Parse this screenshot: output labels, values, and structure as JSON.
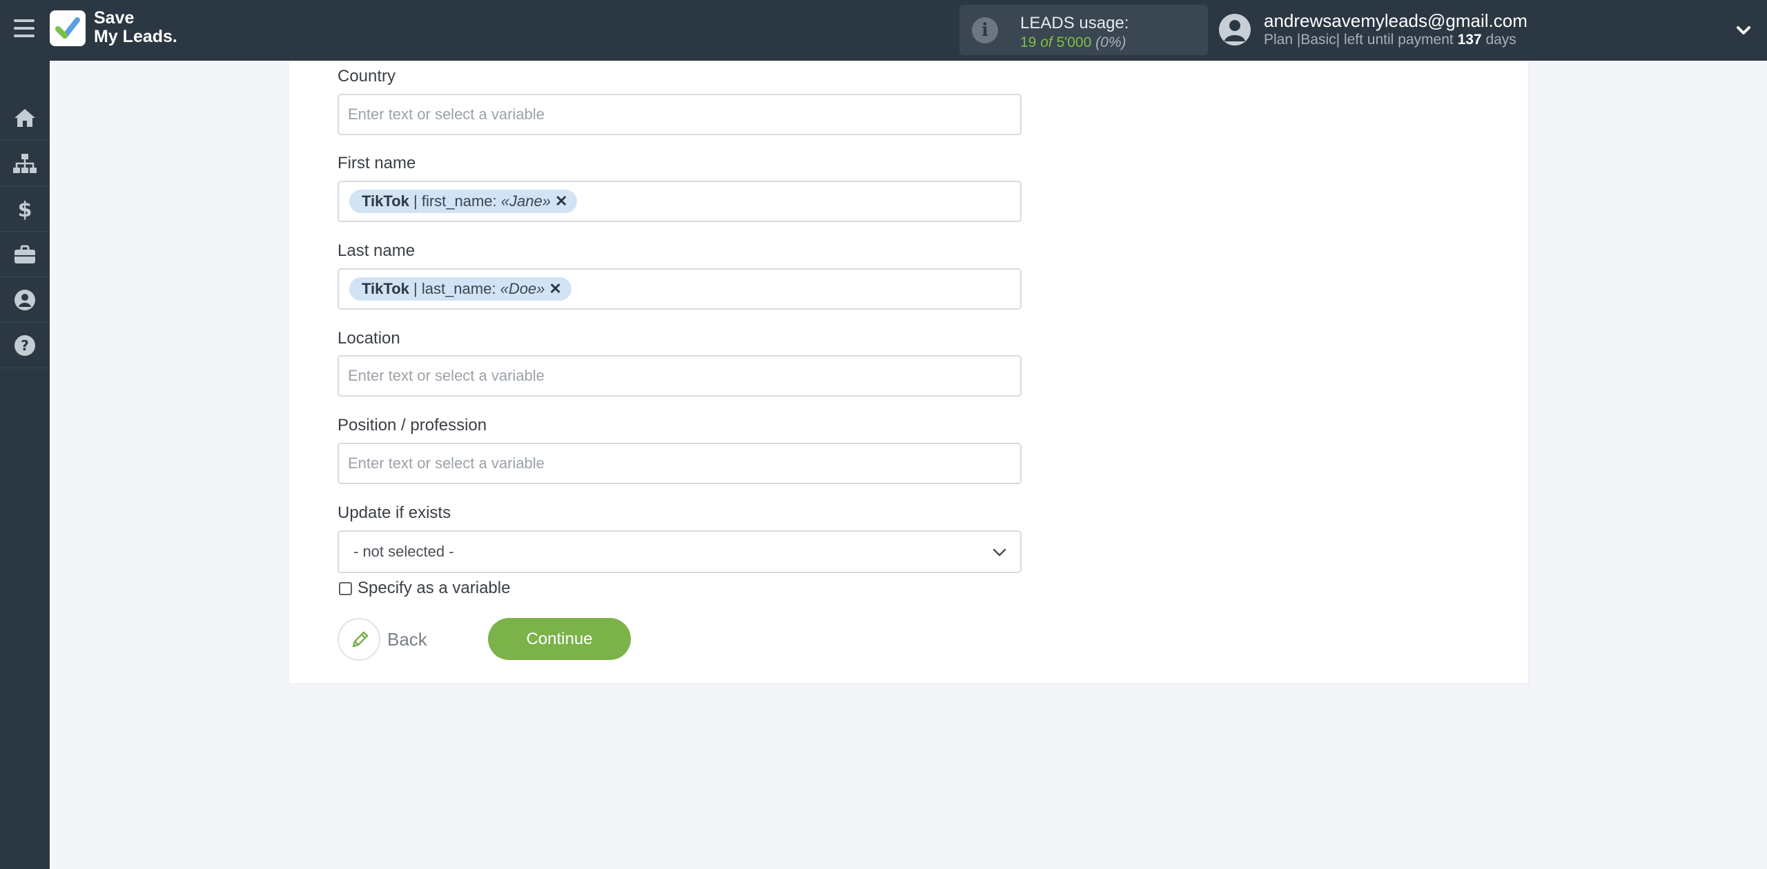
{
  "header": {
    "logo_line1": "Save",
    "logo_line2": "My Leads.",
    "usage": {
      "title": "LEADS usage:",
      "used": "19",
      "of_word": "of",
      "limit": "5'000",
      "percent": "(0%)"
    },
    "user": {
      "email": "andrewsavemyleads@gmail.com",
      "plan_text": "Plan |Basic| left until payment",
      "days_count": "137",
      "days_word": "days"
    }
  },
  "sidebar": {
    "items": [
      {
        "name": "home-icon"
      },
      {
        "name": "sitemap-icon"
      },
      {
        "name": "dollar-icon"
      },
      {
        "name": "briefcase-icon"
      },
      {
        "name": "user-circle-icon"
      },
      {
        "name": "question-circle-icon"
      }
    ]
  },
  "form": {
    "country": {
      "label": "Country",
      "placeholder": "Enter text or select a variable"
    },
    "first_name": {
      "label": "First name",
      "tag": {
        "source": "TikTok",
        "sep": " | ",
        "field": "first_name:",
        "value": "«Jane»",
        "remove": "✕"
      }
    },
    "last_name": {
      "label": "Last name",
      "tag": {
        "source": "TikTok",
        "sep": " | ",
        "field": "last_name:",
        "value": "«Doe»",
        "remove": "✕"
      }
    },
    "location": {
      "label": "Location",
      "placeholder": "Enter text or select a variable"
    },
    "position": {
      "label": "Position / profession",
      "placeholder": "Enter text or select a variable"
    },
    "update_if_exists": {
      "label": "Update if exists",
      "selected": "- not selected -"
    },
    "specify_variable": {
      "label": "Specify as a variable",
      "checked": false
    }
  },
  "actions": {
    "back_label": "Back",
    "continue_label": "Continue"
  },
  "colors": {
    "topbar": "#2b3742",
    "accent_green": "#7bb24a",
    "usage_green": "#7dc144",
    "tag_bg": "#d2e3f5",
    "page_bg": "#f3f5f9"
  }
}
